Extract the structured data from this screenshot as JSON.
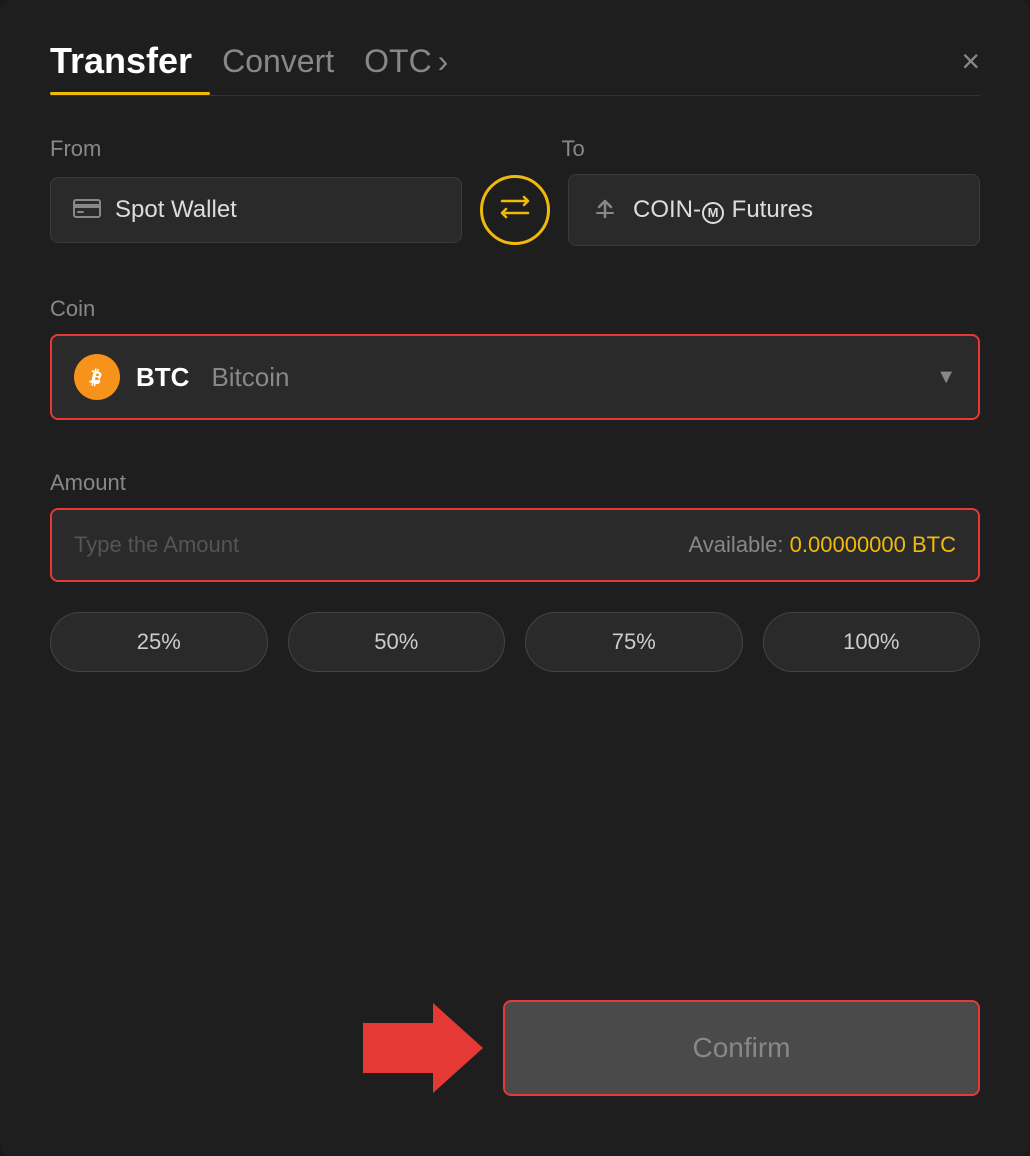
{
  "header": {
    "tab_transfer": "Transfer",
    "tab_convert": "Convert",
    "tab_otc": "OTC",
    "tab_otc_arrow": "›",
    "close_label": "×"
  },
  "from_section": {
    "label": "From",
    "wallet_icon": "💳",
    "wallet_name": "Spot Wallet"
  },
  "to_section": {
    "label": "To",
    "wallet_icon": "↑",
    "wallet_name": "COIN-M Futures"
  },
  "swap": {
    "icon": "⇄"
  },
  "coin": {
    "label": "Coin",
    "symbol": "BTC",
    "full_name": "Bitcoin",
    "icon_letter": "₿"
  },
  "amount": {
    "label": "Amount",
    "placeholder": "Type the Amount",
    "available_label": "Available:",
    "available_value": "0.00000000 BTC"
  },
  "percentages": [
    {
      "label": "25%",
      "value": 25
    },
    {
      "label": "50%",
      "value": 50
    },
    {
      "label": "75%",
      "value": 75
    },
    {
      "label": "100%",
      "value": 100
    }
  ],
  "confirm": {
    "label": "Confirm"
  }
}
